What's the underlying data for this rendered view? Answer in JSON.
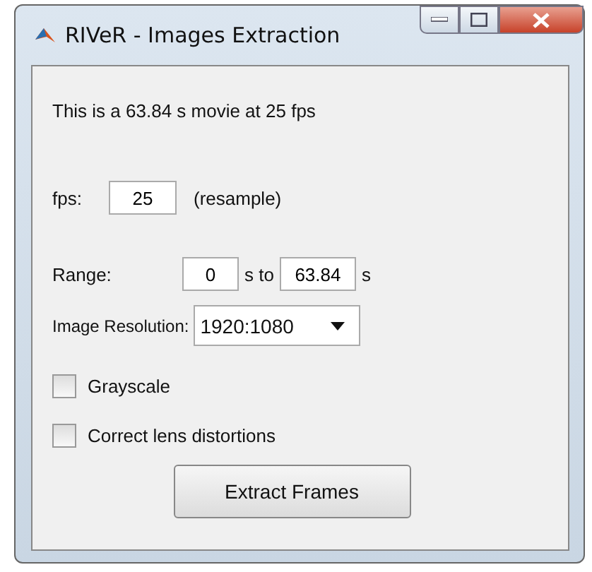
{
  "window": {
    "title": "RIVeR - Images Extraction"
  },
  "info": "This is a 63.84 s movie at 25 fps",
  "fps": {
    "label": "fps:",
    "value": "25",
    "note": "(resample)"
  },
  "range": {
    "label": "Range:",
    "start": "0",
    "middle": "s to",
    "end": "63.84",
    "unit": "s"
  },
  "resolution": {
    "label": "Image Resolution:",
    "value": "1920:1080"
  },
  "options": [
    {
      "label": "Grayscale",
      "checked": false
    },
    {
      "label": "Correct lens distortions",
      "checked": false
    }
  ],
  "button": "Extract Frames"
}
